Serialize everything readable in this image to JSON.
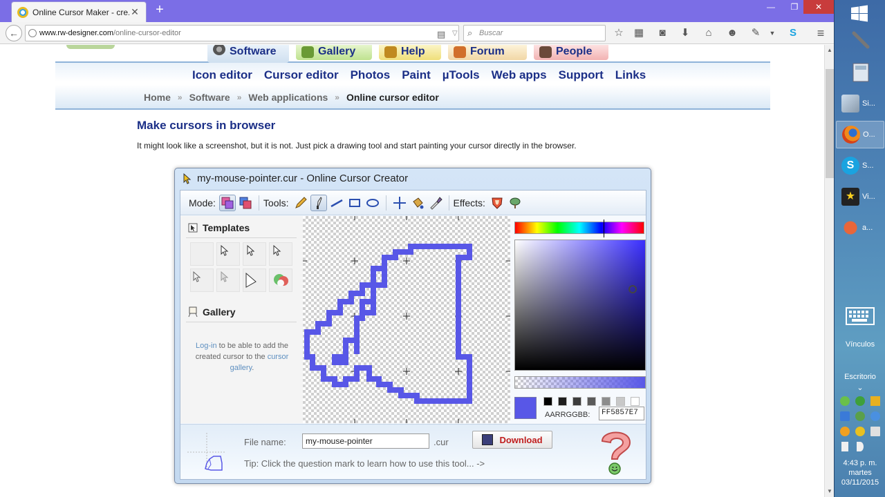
{
  "browser": {
    "tab_title": "Online Cursor Maker - cre...",
    "new_tab": "+",
    "url_host": "www.rw-designer.com",
    "url_path": "/online-cursor-editor",
    "search_placeholder": "Buscar"
  },
  "site": {
    "top_tabs": [
      "Software",
      "Gallery",
      "Help",
      "Forum",
      "People"
    ],
    "nav": [
      "Icon editor",
      "Cursor editor",
      "Photos",
      "Paint",
      "µTools",
      "Web apps",
      "Support",
      "Links"
    ],
    "breadcrumb": [
      "Home",
      "Software",
      "Web applications"
    ],
    "breadcrumb_current": "Online cursor editor",
    "breadcrumb_sep": "»",
    "page_title": "Make cursors in browser",
    "page_desc": "It might look like a screenshot, but it is not. Just pick a drawing tool and start painting your cursor directly in the browser."
  },
  "app": {
    "title": "my-mouse-pointer.cur - Online Cursor Creator",
    "mode_label": "Mode:",
    "tools_label": "Tools:",
    "effects_label": "Effects:",
    "templates_heading": "Templates",
    "gallery_heading": "Gallery",
    "gallery_note": {
      "login": "Log-in",
      "middle": " to be able to add the created cursor to the ",
      "link": "cursor gallery",
      "end": "."
    },
    "color": {
      "argb_label": "AARRGGBB:",
      "argb_value": "FF5857E7",
      "current_hex": "#5857e7",
      "swatches": [
        "#000000",
        "#1e1e1e",
        "#3c3c3c",
        "#5a5a5a",
        "#8c8c8c",
        "#c8c8c8",
        "#ffffff"
      ]
    },
    "file": {
      "label": "File name:",
      "value": "my-mouse-pointer",
      "ext": ".cur",
      "download": "Download",
      "tip": "Tip: Click the question mark to learn how to use this tool... ->"
    }
  },
  "taskbar": {
    "items": [
      {
        "label": "Si...",
        "icon": "tablet-icon"
      },
      {
        "label": "O...",
        "icon": "firefox-icon"
      },
      {
        "label": "S...",
        "icon": "skype-icon"
      },
      {
        "label": "Vi...",
        "icon": "movie-icon"
      },
      {
        "label": "a...",
        "icon": "hand-icon"
      }
    ],
    "links_label": "Vínculos",
    "desktop_label": "Escritorio",
    "time": "4:43 p. m.",
    "day": "martes",
    "date": "03/11/2015"
  }
}
